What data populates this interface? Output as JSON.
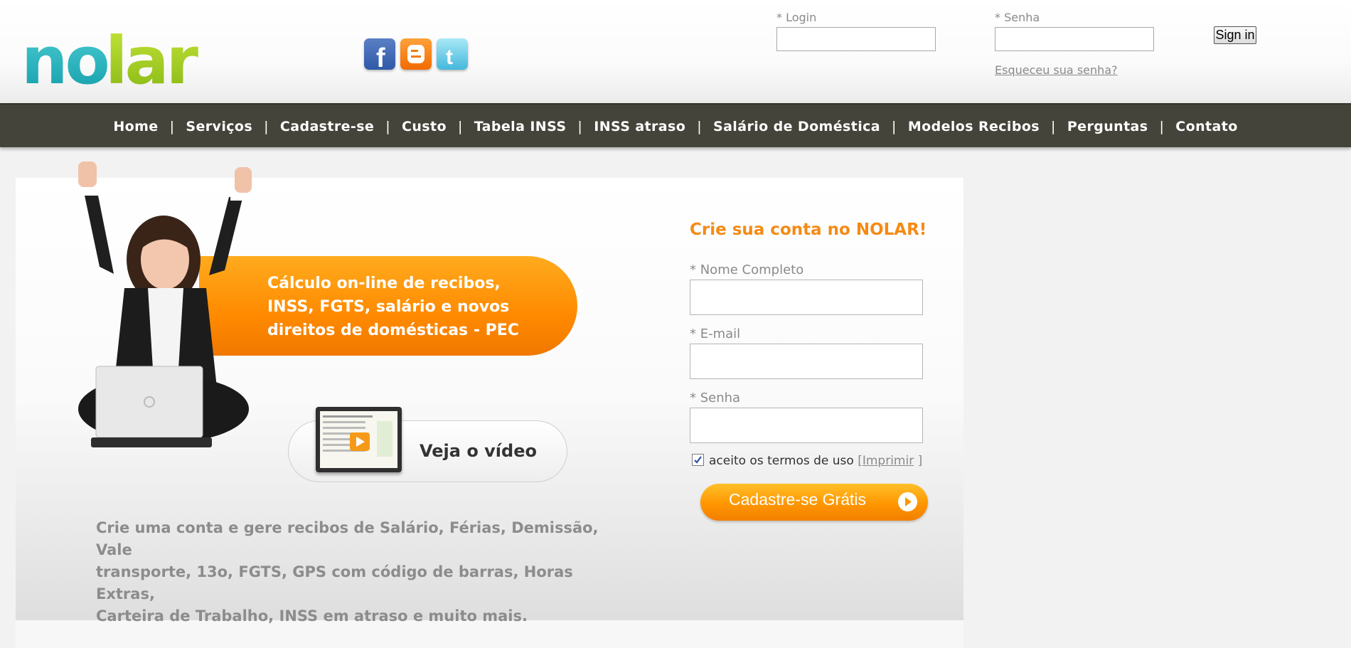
{
  "logo": {
    "text": "nolar"
  },
  "social": [
    {
      "name": "facebook",
      "glyph": "f"
    },
    {
      "name": "blogger",
      "glyph": "B"
    },
    {
      "name": "twitter",
      "glyph": "t"
    }
  ],
  "login": {
    "login_label": "* Login",
    "password_label": "* Senha",
    "signin_label": "Sign in",
    "forgot_label": "Esqueceu sua senha?"
  },
  "nav": {
    "items": [
      "Home",
      "Serviços",
      "Cadastre-se",
      "Custo",
      "Tabela INSS",
      "INSS atraso",
      "Salário de Doméstica",
      "Modelos Recibos",
      "Perguntas",
      "Contato"
    ],
    "separator": "|"
  },
  "hero": {
    "promo_lines": [
      "Cálculo on-line de recibos,",
      "INSS, FGTS, salário e novos",
      "direitos de domésticas - PEC"
    ],
    "video_label": "Veja o vídeo",
    "description_lines": [
      "Crie uma conta e gere recibos de Salário, Férias, Demissão, Vale",
      "transporte, 13o, FGTS, GPS com código de barras, Horas Extras,",
      "Carteira de Trabalho, INSS em atraso e muito mais."
    ]
  },
  "signup": {
    "title": "Crie sua conta no NOLAR!",
    "name_label": "* Nome Completo",
    "email_label": "* E-mail",
    "password_label": "* Senha",
    "terms_text": "aceito os termos de uso",
    "terms_open": "[",
    "terms_link": "Imprimir",
    "terms_close": "]",
    "terms_checked": true,
    "cta_label": "Cadastre-se Grátis"
  }
}
